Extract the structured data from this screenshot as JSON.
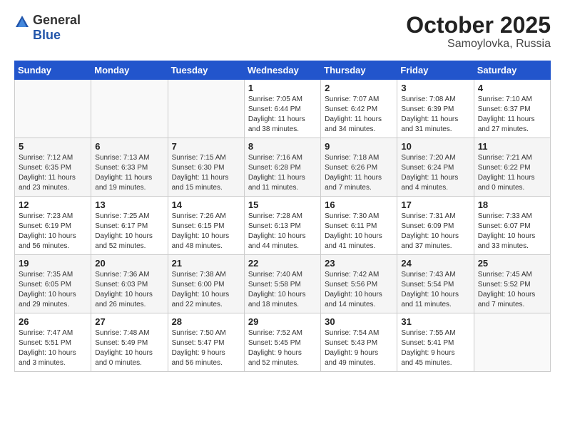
{
  "logo": {
    "general": "General",
    "blue": "Blue"
  },
  "header": {
    "month": "October 2025",
    "location": "Samoylovka, Russia"
  },
  "weekdays": [
    "Sunday",
    "Monday",
    "Tuesday",
    "Wednesday",
    "Thursday",
    "Friday",
    "Saturday"
  ],
  "weeks": [
    [
      {
        "day": "",
        "info": ""
      },
      {
        "day": "",
        "info": ""
      },
      {
        "day": "",
        "info": ""
      },
      {
        "day": "1",
        "info": "Sunrise: 7:05 AM\nSunset: 6:44 PM\nDaylight: 11 hours\nand 38 minutes."
      },
      {
        "day": "2",
        "info": "Sunrise: 7:07 AM\nSunset: 6:42 PM\nDaylight: 11 hours\nand 34 minutes."
      },
      {
        "day": "3",
        "info": "Sunrise: 7:08 AM\nSunset: 6:39 PM\nDaylight: 11 hours\nand 31 minutes."
      },
      {
        "day": "4",
        "info": "Sunrise: 7:10 AM\nSunset: 6:37 PM\nDaylight: 11 hours\nand 27 minutes."
      }
    ],
    [
      {
        "day": "5",
        "info": "Sunrise: 7:12 AM\nSunset: 6:35 PM\nDaylight: 11 hours\nand 23 minutes."
      },
      {
        "day": "6",
        "info": "Sunrise: 7:13 AM\nSunset: 6:33 PM\nDaylight: 11 hours\nand 19 minutes."
      },
      {
        "day": "7",
        "info": "Sunrise: 7:15 AM\nSunset: 6:30 PM\nDaylight: 11 hours\nand 15 minutes."
      },
      {
        "day": "8",
        "info": "Sunrise: 7:16 AM\nSunset: 6:28 PM\nDaylight: 11 hours\nand 11 minutes."
      },
      {
        "day": "9",
        "info": "Sunrise: 7:18 AM\nSunset: 6:26 PM\nDaylight: 11 hours\nand 7 minutes."
      },
      {
        "day": "10",
        "info": "Sunrise: 7:20 AM\nSunset: 6:24 PM\nDaylight: 11 hours\nand 4 minutes."
      },
      {
        "day": "11",
        "info": "Sunrise: 7:21 AM\nSunset: 6:22 PM\nDaylight: 11 hours\nand 0 minutes."
      }
    ],
    [
      {
        "day": "12",
        "info": "Sunrise: 7:23 AM\nSunset: 6:19 PM\nDaylight: 10 hours\nand 56 minutes."
      },
      {
        "day": "13",
        "info": "Sunrise: 7:25 AM\nSunset: 6:17 PM\nDaylight: 10 hours\nand 52 minutes."
      },
      {
        "day": "14",
        "info": "Sunrise: 7:26 AM\nSunset: 6:15 PM\nDaylight: 10 hours\nand 48 minutes."
      },
      {
        "day": "15",
        "info": "Sunrise: 7:28 AM\nSunset: 6:13 PM\nDaylight: 10 hours\nand 44 minutes."
      },
      {
        "day": "16",
        "info": "Sunrise: 7:30 AM\nSunset: 6:11 PM\nDaylight: 10 hours\nand 41 minutes."
      },
      {
        "day": "17",
        "info": "Sunrise: 7:31 AM\nSunset: 6:09 PM\nDaylight: 10 hours\nand 37 minutes."
      },
      {
        "day": "18",
        "info": "Sunrise: 7:33 AM\nSunset: 6:07 PM\nDaylight: 10 hours\nand 33 minutes."
      }
    ],
    [
      {
        "day": "19",
        "info": "Sunrise: 7:35 AM\nSunset: 6:05 PM\nDaylight: 10 hours\nand 29 minutes."
      },
      {
        "day": "20",
        "info": "Sunrise: 7:36 AM\nSunset: 6:03 PM\nDaylight: 10 hours\nand 26 minutes."
      },
      {
        "day": "21",
        "info": "Sunrise: 7:38 AM\nSunset: 6:00 PM\nDaylight: 10 hours\nand 22 minutes."
      },
      {
        "day": "22",
        "info": "Sunrise: 7:40 AM\nSunset: 5:58 PM\nDaylight: 10 hours\nand 18 minutes."
      },
      {
        "day": "23",
        "info": "Sunrise: 7:42 AM\nSunset: 5:56 PM\nDaylight: 10 hours\nand 14 minutes."
      },
      {
        "day": "24",
        "info": "Sunrise: 7:43 AM\nSunset: 5:54 PM\nDaylight: 10 hours\nand 11 minutes."
      },
      {
        "day": "25",
        "info": "Sunrise: 7:45 AM\nSunset: 5:52 PM\nDaylight: 10 hours\nand 7 minutes."
      }
    ],
    [
      {
        "day": "26",
        "info": "Sunrise: 7:47 AM\nSunset: 5:51 PM\nDaylight: 10 hours\nand 3 minutes."
      },
      {
        "day": "27",
        "info": "Sunrise: 7:48 AM\nSunset: 5:49 PM\nDaylight: 10 hours\nand 0 minutes."
      },
      {
        "day": "28",
        "info": "Sunrise: 7:50 AM\nSunset: 5:47 PM\nDaylight: 9 hours\nand 56 minutes."
      },
      {
        "day": "29",
        "info": "Sunrise: 7:52 AM\nSunset: 5:45 PM\nDaylight: 9 hours\nand 52 minutes."
      },
      {
        "day": "30",
        "info": "Sunrise: 7:54 AM\nSunset: 5:43 PM\nDaylight: 9 hours\nand 49 minutes."
      },
      {
        "day": "31",
        "info": "Sunrise: 7:55 AM\nSunset: 5:41 PM\nDaylight: 9 hours\nand 45 minutes."
      },
      {
        "day": "",
        "info": ""
      }
    ]
  ]
}
